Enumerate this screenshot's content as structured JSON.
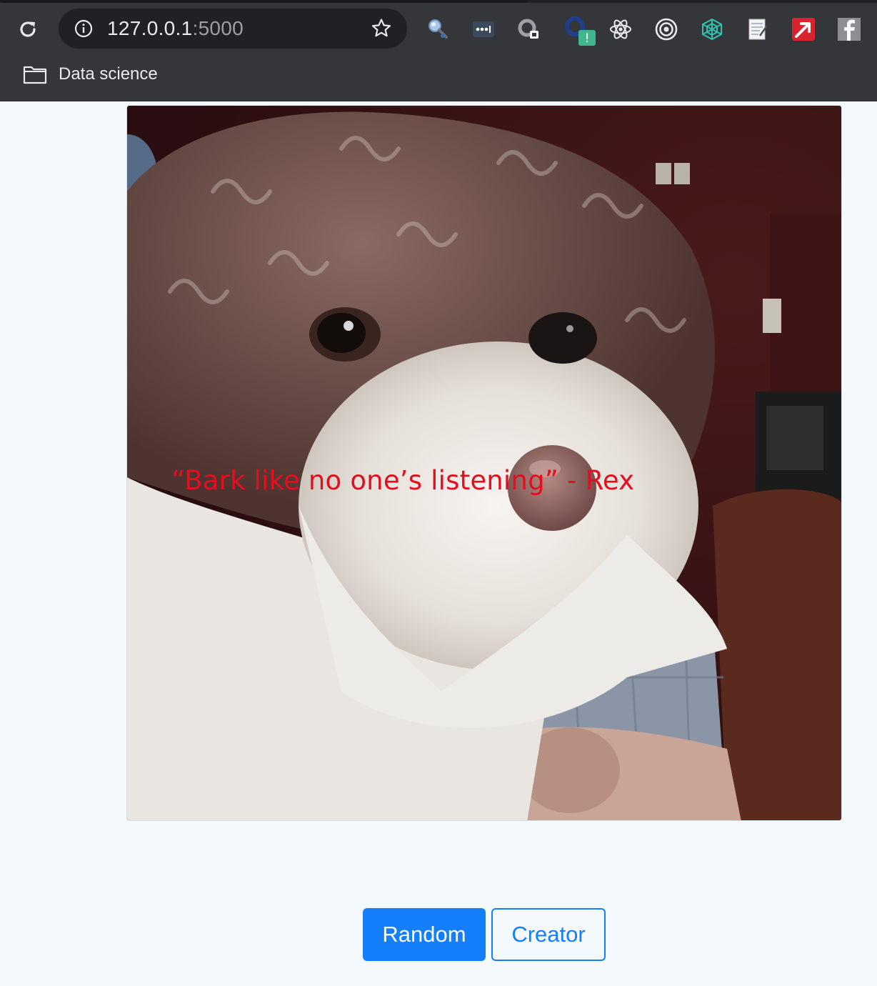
{
  "browser": {
    "url_host": "127.0.0.1",
    "url_port": ":5000",
    "bookmark_label": "Data science",
    "extensions": [
      "magnifier-extension-icon",
      "password-dots-extension-icon",
      "screen-capture-extension-icon",
      "warning-badge-extension-icon",
      "react-devtools-icon",
      "target-circle-icon",
      "web-extension-icon",
      "notepad-extension-icon",
      "red-arrow-extension-icon",
      "facebook-extension-icon"
    ],
    "extension_badge": "!"
  },
  "image": {
    "caption": "“Bark like no one’s listening” - Rex",
    "caption_color": "#e01020"
  },
  "actions": {
    "random_label": "Random",
    "creator_label": "Creator",
    "accent": "#157ffb"
  }
}
